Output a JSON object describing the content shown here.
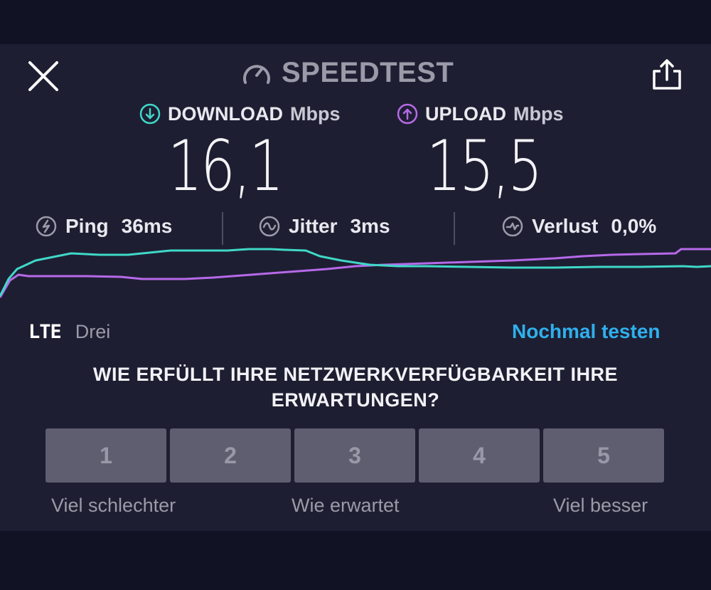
{
  "header": {
    "title": "SPEEDTEST",
    "close_icon": "close-icon",
    "share_icon": "share-icon",
    "gauge_icon": "speedometer-icon"
  },
  "download": {
    "label": "DOWNLOAD",
    "unit": "Mbps",
    "value": "16,1",
    "color": "#3fd8c8",
    "icon": "arrow-down-circle-icon"
  },
  "upload": {
    "label": "UPLOAD",
    "unit": "Mbps",
    "value": "15,5",
    "color": "#b669e8",
    "icon": "arrow-up-circle-icon"
  },
  "stats": {
    "ping": {
      "label": "Ping",
      "value": "36ms",
      "icon": "ping-icon"
    },
    "jitter": {
      "label": "Jitter",
      "value": "3ms",
      "icon": "jitter-icon"
    },
    "loss": {
      "label": "Verlust",
      "value": "0,0%",
      "icon": "packet-loss-icon"
    }
  },
  "connection": {
    "technology": "LTE",
    "carrier": "Drei"
  },
  "retest_label": "Nochmal testen",
  "survey": {
    "question_line1": "WIE ERFÜLLT IHRE NETZWERKVERFÜGBARKEIT IHRE",
    "question_line2": "ERWARTUNGEN?",
    "options": [
      "1",
      "2",
      "3",
      "4",
      "5"
    ],
    "scale_low": "Viel schlechter",
    "scale_mid": "Wie erwartet",
    "scale_high": "Viel besser"
  },
  "colors": {
    "background": "#1e1e32",
    "download": "#3fd8c8",
    "upload": "#b669e8",
    "accent": "#2fb0ec",
    "rating_button": "#5e5e70"
  }
}
